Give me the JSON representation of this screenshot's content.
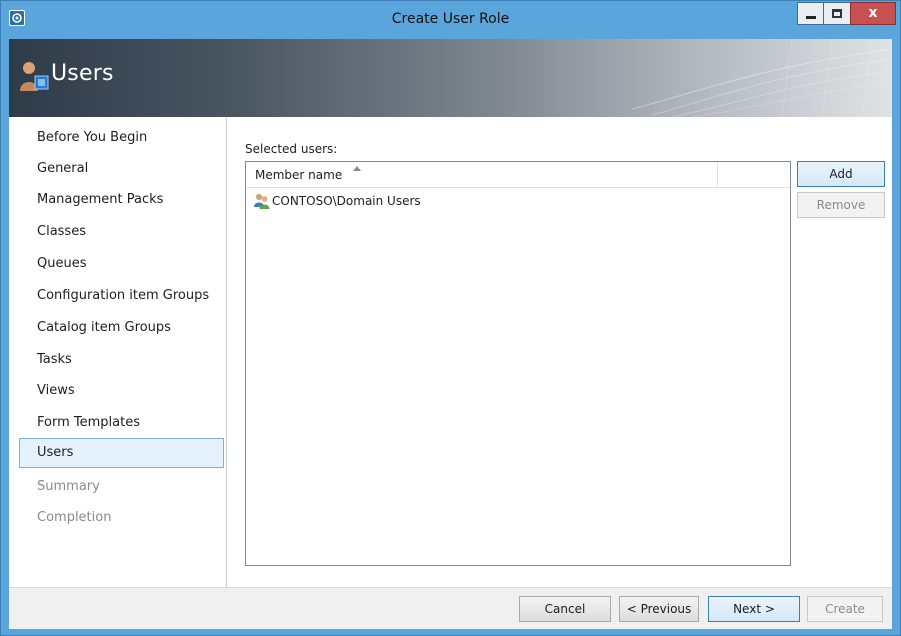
{
  "window": {
    "title": "Create User Role"
  },
  "titlebar": {
    "close_glyph": "x"
  },
  "banner": {
    "title": "Users",
    "icon": "users-icon"
  },
  "nav": {
    "items": [
      {
        "label": "Before You Begin",
        "state": "normal"
      },
      {
        "label": "General",
        "state": "normal"
      },
      {
        "label": "Management Packs",
        "state": "normal"
      },
      {
        "label": "Classes",
        "state": "normal"
      },
      {
        "label": "Queues",
        "state": "normal"
      },
      {
        "label": "Configuration item Groups",
        "state": "normal"
      },
      {
        "label": "Catalog item Groups",
        "state": "normal"
      },
      {
        "label": "Tasks",
        "state": "normal"
      },
      {
        "label": "Views",
        "state": "normal"
      },
      {
        "label": "Form Templates",
        "state": "normal"
      },
      {
        "label": "Users",
        "state": "selected"
      },
      {
        "label": "Summary",
        "state": "disabled"
      },
      {
        "label": "Completion",
        "state": "disabled"
      }
    ]
  },
  "main": {
    "selected_users_label": "Selected users:",
    "column_header": "Member name",
    "sort": "ascending",
    "rows": [
      {
        "name": "CONTOSO\\Domain Users",
        "icon": "group-icon"
      }
    ],
    "add_label": "Add",
    "remove_label": "Remove"
  },
  "footer": {
    "cancel_label": "Cancel",
    "previous_label": "< Previous",
    "next_label": "Next >",
    "create_label": "Create"
  },
  "colors": {
    "window_frame": "#5aa6dc",
    "close_button": "#c75050",
    "selection_bg": "#e5f1fb",
    "selection_border": "#7fb0d6",
    "disabled_text": "#8b8b8b"
  }
}
